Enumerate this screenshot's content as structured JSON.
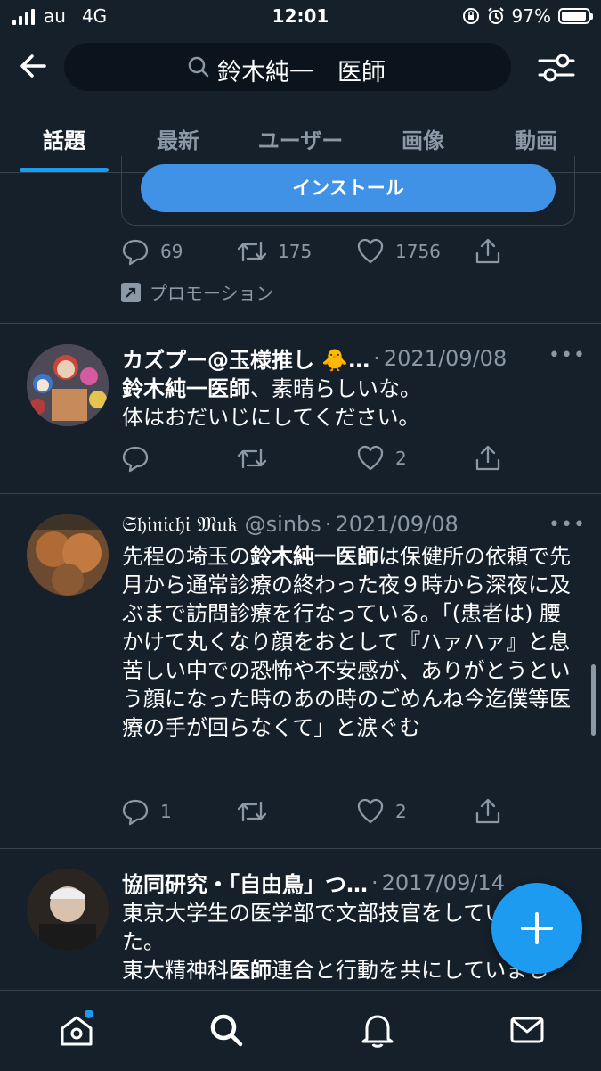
{
  "status_bar": {
    "carrier": "au",
    "network": "4G",
    "time": "12:01",
    "battery_percent": "97%",
    "battery_level": 0.97
  },
  "search": {
    "query": "鈴木純一　医師"
  },
  "tabs": [
    {
      "label": "話題",
      "active": true
    },
    {
      "label": "最新",
      "active": false
    },
    {
      "label": "ユーザー",
      "active": false
    },
    {
      "label": "画像",
      "active": false
    },
    {
      "label": "動画",
      "active": false
    }
  ],
  "promoted": {
    "install_label": "インストール",
    "replies": "69",
    "retweets": "175",
    "likes": "1756",
    "promotion_label": "プロモーション"
  },
  "tweets": [
    {
      "name": "カズプー@玉様推し 🐥…",
      "handle": "",
      "date": "2021/09/08",
      "body_bold": "鈴木純一医師",
      "body_rest": "、素晴らしいな。",
      "body_line2": "体はおだいじにしてください。",
      "replies": "",
      "retweets": "",
      "likes": "2"
    },
    {
      "name": "𝔖𝔥𝔦𝔫𝔦𝔠𝔥𝔦 𝔐𝔲𝔨",
      "handle": "@sinbs",
      "date": "2021/09/08",
      "body_pre": "先程の埼玉の",
      "body_bold": "鈴木純一医師",
      "body_post": "は保健所の依頼で先月から通常診療の終わった夜９時から深夜に及ぶまで訪問診療を行なっている。「(患者は) 腰かけて丸くなり顔をおとして『ハァハァ』と息苦しい中での恐怖や不安感が、ありがとうという顔になった時のあの時のごめんね今迄僕等医療の手が回らなくて」と涙ぐむ",
      "replies": "1",
      "retweets": "",
      "likes": "2"
    },
    {
      "name": "協同研究・「自由鳥」つ…",
      "handle": "",
      "date": "2017/09/14",
      "body_line1": "東京大学生の医学部で文部技官をしていました。",
      "body_line2_pre": "東大精神科",
      "body_line2_bold": "医師",
      "body_line2_post": "連合と行動を共にしていまし"
    }
  ]
}
